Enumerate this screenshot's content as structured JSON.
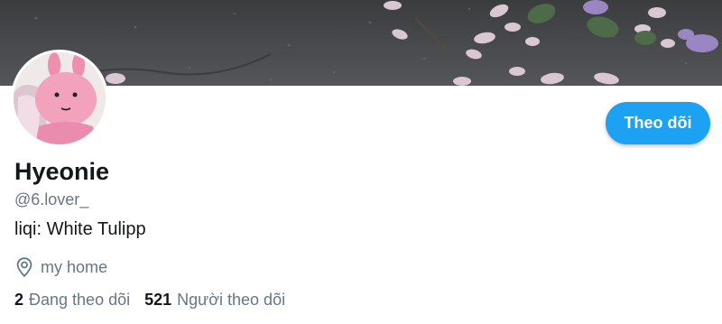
{
  "profile": {
    "display_name": "Hyeonie",
    "handle": "@6.lover_",
    "bio": "liqi: White Tulipp",
    "location": "my home",
    "follow_button_label": "Theo dõi"
  },
  "stats": {
    "following_count": "2",
    "following_label": "Đang theo dõi",
    "followers_count": "521",
    "followers_label": "Người theo dõi"
  },
  "icons": {
    "location": "map-pin-icon"
  },
  "colors": {
    "accent": "#1da1f2",
    "secondary_text": "#657786",
    "primary_text": "#14171a"
  }
}
